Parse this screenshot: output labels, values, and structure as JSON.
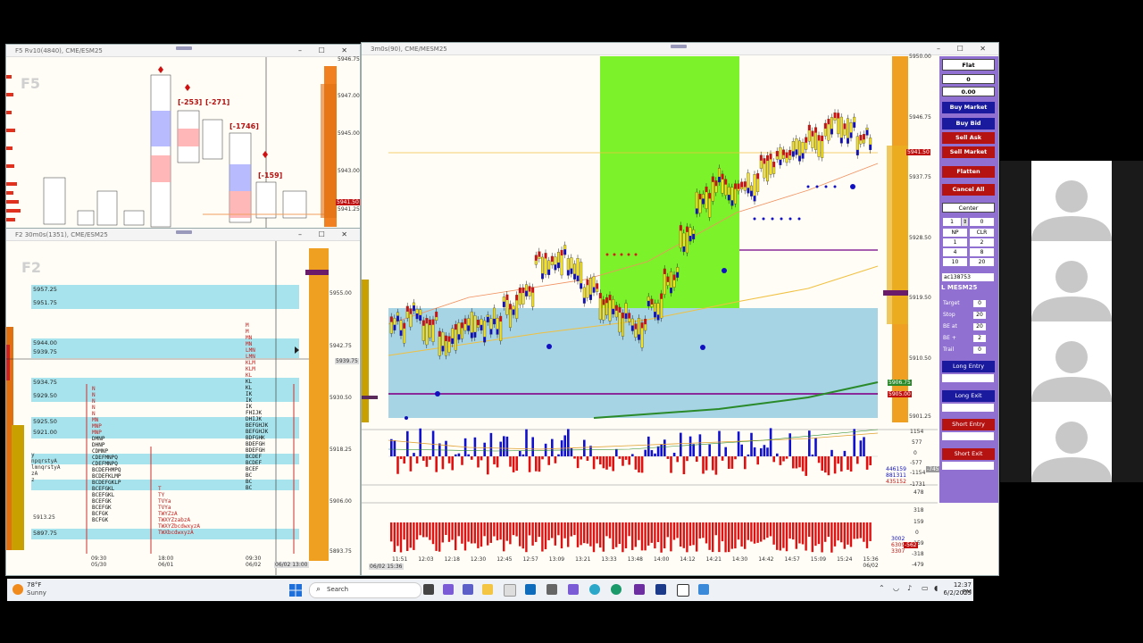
{
  "windows": {
    "f5": {
      "title": "F5 Rv10(4840), CME/ESM25",
      "label": "F5",
      "prices": [
        "5946.75",
        "5947.00",
        "5945.00",
        "5943.00",
        "5941.25"
      ],
      "current_price": "5941.50",
      "delta_labels": [
        "[-253]",
        "[-271]",
        "[-1746]",
        "[-159]"
      ]
    },
    "f2": {
      "title": "F2 30m0s(1351), CME/ESM25",
      "label": "F2",
      "prices": [
        "5955.00",
        "5942.75",
        "5930.50",
        "5918.25",
        "5906.00",
        "5893.75"
      ],
      "current_price": "5939.75",
      "zones": [
        "5957.25",
        "5951.75",
        "5944.00",
        "5939.75",
        "5934.75",
        "5929.50",
        "5925.50",
        "5921.00",
        "5897.75"
      ],
      "extra_labels": [
        "5913.25"
      ],
      "times": [
        "09:30\n05/30",
        "18:00\n06/01",
        "09:30\n06/02"
      ],
      "time_highlight": "06/02 13:00"
    },
    "main": {
      "title": "3m0s(90), CME/MESM25",
      "prices": [
        "5950.00",
        "5946.75",
        "5937.75",
        "5928.50",
        "5919.50",
        "5910.50",
        "5901.25"
      ],
      "current_price": "5941.50",
      "tag_906": "5906.75",
      "tag_905": "5905.00",
      "times": [
        "11:51",
        "12:03",
        "12:18",
        "12:30",
        "12:45",
        "12:57",
        "13:09",
        "13:21",
        "13:33",
        "13:48",
        "14:00",
        "14:12",
        "14:21",
        "14:30",
        "14:42",
        "14:57",
        "15:09",
        "15:24",
        "15:36\n06/02"
      ],
      "cursor_time": "06/02 15:36",
      "sub_levels_1": [
        "1154",
        "577",
        "0",
        "-577",
        "-1154",
        "-1731"
      ],
      "sub_values_1": [
        "446159",
        "881311",
        "435152"
      ],
      "sub_tag_1": "-745",
      "sub_levels_2": [
        "478",
        "318",
        "159",
        "0",
        "-159",
        "-318",
        "-479"
      ],
      "sub_values_2": [
        "3002",
        "6309",
        "3307"
      ],
      "sub_tag_2": "-562"
    }
  },
  "trade_panel": {
    "position": "Flat",
    "qty": "0",
    "pnl": "0.00",
    "buy_market": "Buy Market",
    "buy_bid": "Buy Bid",
    "sell_ask": "Sell Ask",
    "sell_market": "Sell Market",
    "flatten": "Flatten",
    "cancel_all": "Cancel All",
    "center": "Center",
    "qty_value": "1",
    "qty_right": "0",
    "grid": [
      "NP",
      "CLR",
      "1",
      "2",
      "4",
      "8",
      "10",
      "20"
    ],
    "account": "ac138753",
    "symbol": "L MESM25",
    "params": [
      {
        "label": "Target",
        "value": "0"
      },
      {
        "label": "Stop",
        "value": "20"
      },
      {
        "label": "BE at",
        "value": "20"
      },
      {
        "label": "BE +",
        "value": "2"
      },
      {
        "label": "Trail",
        "value": "0"
      }
    ],
    "long_entry": "Long Entry",
    "long_exit": "Long Exit",
    "short_entry": "Short Entry",
    "short_exit": "Short Exit"
  },
  "taskbar": {
    "weather_temp": "78°F",
    "weather_desc": "Sunny",
    "search_placeholder": "Search",
    "time": "12:37 PM",
    "date": "6/2/2025"
  },
  "colors": {
    "green_zone": "#7cf22a",
    "zone_blue": "#a6e3ec",
    "panel_purple": "#9070d0",
    "buy_blue": "#1a1a9e",
    "sell_red": "#b51212"
  }
}
